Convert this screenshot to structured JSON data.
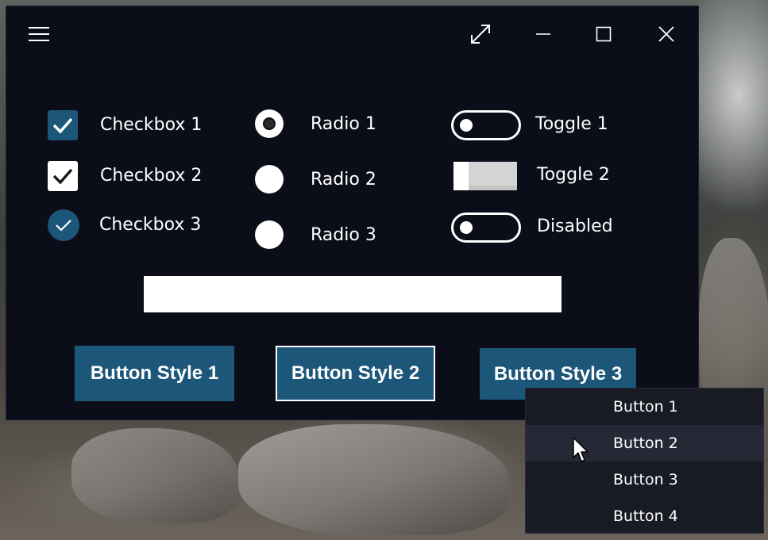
{
  "checkboxes": [
    {
      "label": "Checkbox 1",
      "checked": true
    },
    {
      "label": "Checkbox 2",
      "checked": true
    },
    {
      "label": "Checkbox 3",
      "checked": true
    }
  ],
  "radios": [
    {
      "label": "Radio 1",
      "selected": true
    },
    {
      "label": "Radio 2",
      "selected": false
    },
    {
      "label": "Radio 3",
      "selected": false
    }
  ],
  "toggles": [
    {
      "label": "Toggle 1",
      "on": false
    },
    {
      "label": "Toggle 2",
      "on": false
    },
    {
      "label": "Disabled",
      "on": false
    }
  ],
  "textbox": {
    "value": "",
    "placeholder": ""
  },
  "buttons": [
    {
      "label": "Button Style 1"
    },
    {
      "label": "Button Style 2"
    },
    {
      "label": "Button Style 3"
    }
  ],
  "menu": {
    "items": [
      {
        "label": "Button 1"
      },
      {
        "label": "Button 2"
      },
      {
        "label": "Button 3"
      },
      {
        "label": "Button 4"
      }
    ],
    "hovered_index": 1
  },
  "colors": {
    "window_bg": "#0b0e19",
    "accent": "#1c5679",
    "menu_bg": "#181a24",
    "menu_hover": "#262935"
  }
}
